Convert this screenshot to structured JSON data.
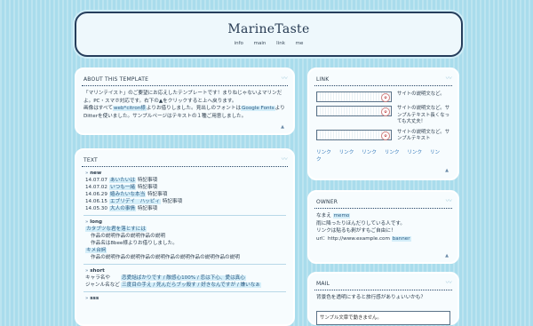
{
  "site": {
    "title": "MarineTaste",
    "nav": [
      "info",
      "main",
      "link",
      "me"
    ]
  },
  "about": {
    "title": "ABOUT THIS TEMPLATE",
    "lines": [
      [
        "「マリンテイスト」のご要望にお応えしたテンプレートです！まりねじゃないよマリンだよ。PC・スマホ対応です。右下の",
        [
          "▲"
        ],
        "をクリックすると上へ戻ります。"
      ],
      [
        "画像はすべて",
        {
          "hl": "web*citron様"
        },
        "よりお借りしました。見出しのフォントは",
        {
          "hl": "Google Fonts"
        },
        "よりDitterを使いました。サンプルページはテキストの１種ご用意しました。"
      ]
    ],
    "text1": "「マリンテイスト」のご要望にお応えしたテンプレートです！まりねじゃないよマリンだよ。PC・スマホ対応です。右下の▲をクリックすると上へ戻ります。",
    "text2a": "画像はすべて",
    "text2b": "web*citron様",
    "text2c": "よりお借りしました。見出しのフォントは",
    "text2d": "Google Fonts",
    "text2e": "よりDitterを使いました。サンプルページはテキストの１種ご用意しました。"
  },
  "text_panel": {
    "title": "TEXT",
    "new_heading": "new",
    "new_rows": [
      {
        "date": "14.07.07",
        "cat": "あいたいは",
        "note": "特記事項"
      },
      {
        "date": "14.07.02",
        "cat": "いつも一緒",
        "note": "特記事項"
      },
      {
        "date": "14.06.29",
        "cat": "嬉みたいな本当",
        "note": "特記事項"
      },
      {
        "date": "14.06.15",
        "cat": "エブリデイ　ハッピィ",
        "note": "特記事項"
      },
      {
        "date": "14.05.30",
        "cat": "大人の事情",
        "note": "特記事項"
      }
    ],
    "long_heading": "long",
    "long_link1": "カタブツな君を落とすには",
    "long_desc1a": "作品の説明作品の説明作品の説明",
    "long_desc1b": "作品名は8bee様よりお借りしました。",
    "long_link2": "キメ台詞",
    "long_desc2": "作品の説明作品の説明作品の説明作品の説明作品の説明作品の説明",
    "short_heading": "short",
    "short_row1_label": "キャラ名や",
    "short_row1_items": "恋愛話ばかりです / 敵感心100% / 恋は下心、愛は真心",
    "short_row2_label": "ジャンル名など",
    "short_row2_items": "三度目の手え / 死んだらブッ殺す / 好きなんですが / 嫌いなぁ",
    "sss_heading": "sss"
  },
  "link": {
    "title": "LINK",
    "banners": [
      {
        "desc": "サイトの説明文など。"
      },
      {
        "desc": "サイトの説明文など。サンプルテキスト長くなっても大丈夫！"
      },
      {
        "desc": "サイトの説明文など。サンプルテキスト"
      }
    ],
    "text_links": [
      "リンク",
      "リンク",
      "リンク",
      "リンク",
      "リンク",
      "リンク"
    ]
  },
  "owner": {
    "title": "OWNER",
    "name_label": "なまえ",
    "name_value": "memo",
    "line2": "雨に降ったりほんだりしている人です。",
    "line3": "リンクは貼るも剥がすもご自由に！",
    "url_label": "url：http://www.example.com",
    "banner_label": "banner"
  },
  "mail": {
    "title": "MAIL",
    "desc": "背景色を透明にすると旅行感がありょいいかも？",
    "input_text": "サンプル文章で動きません。"
  }
}
